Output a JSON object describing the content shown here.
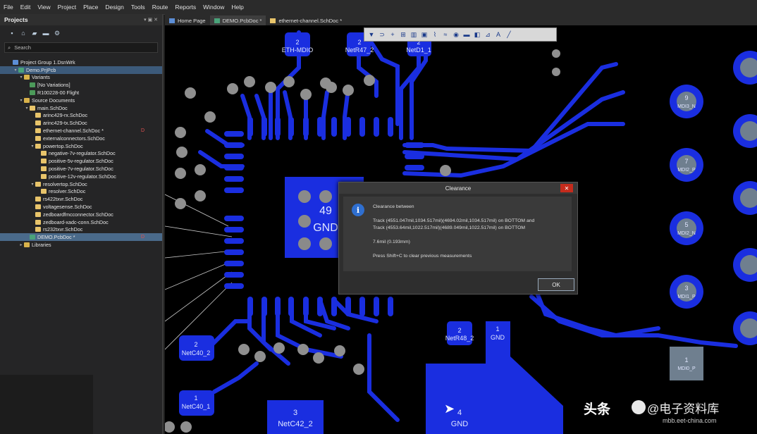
{
  "menu": [
    "File",
    "Edit",
    "View",
    "Project",
    "Place",
    "Design",
    "Tools",
    "Route",
    "Reports",
    "Window",
    "Help"
  ],
  "projects_panel": {
    "title": "Projects",
    "pin": "▾ ▣ ✕",
    "search_placeholder": "Search",
    "tree": [
      {
        "label": "Project Group 1.DsnWrk",
        "indent": 0,
        "icon": "prj",
        "arrow": ""
      },
      {
        "label": "Demo.PrjPcb",
        "indent": 1,
        "icon": "pcb",
        "arrow": "▾",
        "selected": true
      },
      {
        "label": "Variants",
        "indent": 2,
        "icon": "folder",
        "arrow": "▾"
      },
      {
        "label": "[No Variations]",
        "indent": 3,
        "icon": "var",
        "arrow": ""
      },
      {
        "label": "R100228-00 Flight",
        "indent": 3,
        "icon": "var",
        "arrow": ""
      },
      {
        "label": "Source Documents",
        "indent": 2,
        "icon": "folder",
        "arrow": "▾"
      },
      {
        "label": "main.SchDoc",
        "indent": 3,
        "icon": "sch",
        "arrow": "▾"
      },
      {
        "label": "arinc429-rx.SchDoc",
        "indent": 4,
        "icon": "sch",
        "arrow": ""
      },
      {
        "label": "arinc429-tx.SchDoc",
        "indent": 4,
        "icon": "sch",
        "arrow": ""
      },
      {
        "label": "ethernet-channel.SchDoc *",
        "indent": 4,
        "icon": "sch",
        "arrow": "",
        "mark": "D"
      },
      {
        "label": "externalconnectors.SchDoc",
        "indent": 4,
        "icon": "sch",
        "arrow": ""
      },
      {
        "label": "powertop.SchDoc",
        "indent": 4,
        "icon": "sch",
        "arrow": "▾"
      },
      {
        "label": "negative-7v-regulator.SchDoc",
        "indent": 5,
        "icon": "sch",
        "arrow": ""
      },
      {
        "label": "positive-5v-regulator.SchDoc",
        "indent": 5,
        "icon": "sch",
        "arrow": ""
      },
      {
        "label": "positive-7v-regulator.SchDoc",
        "indent": 5,
        "icon": "sch",
        "arrow": ""
      },
      {
        "label": "positive-12v-regulator.SchDoc",
        "indent": 5,
        "icon": "sch",
        "arrow": ""
      },
      {
        "label": "resolvertop.SchDoc",
        "indent": 4,
        "icon": "sch",
        "arrow": "▾"
      },
      {
        "label": "resolver.SchDoc",
        "indent": 5,
        "icon": "sch",
        "arrow": ""
      },
      {
        "label": "rs422txvr.SchDoc",
        "indent": 4,
        "icon": "sch",
        "arrow": ""
      },
      {
        "label": "voltagesense.SchDoc",
        "indent": 4,
        "icon": "sch",
        "arrow": ""
      },
      {
        "label": "zedboardfmcconnector.SchDoc",
        "indent": 4,
        "icon": "sch",
        "arrow": ""
      },
      {
        "label": "zedboard-xadc-conn.SchDoc",
        "indent": 4,
        "icon": "sch",
        "arrow": ""
      },
      {
        "label": "rs232txvr.SchDoc",
        "indent": 4,
        "icon": "sch",
        "arrow": ""
      },
      {
        "label": "DEMO.PcbDoc *",
        "indent": 3,
        "icon": "pcb",
        "arrow": "",
        "mark": "D",
        "highlight": true
      },
      {
        "label": "Libraries",
        "indent": 2,
        "icon": "folder",
        "arrow": "▸"
      }
    ]
  },
  "tabs": [
    {
      "label": "Home Page",
      "active": false
    },
    {
      "label": "DEMO.PcbDoc *",
      "active": true
    },
    {
      "label": "ethernet-channel.SchDoc *",
      "active": false
    }
  ],
  "pcb_labels": {
    "eth_mdio_num": "2",
    "eth_mdio": "ETH-MDIO",
    "netr47_num": "2",
    "netr47": "NetR47_2",
    "netd1_num": "2",
    "netd1": "NetD1_1",
    "gnd49_num": "49",
    "gnd49": "GND",
    "netr48_num": "2",
    "netr48": "NetR48_2",
    "gnd1_num": "1",
    "gnd1": "GND",
    "netc40_2_num": "2",
    "netc40_2": "NetC40_2",
    "netc40_1_num": "1",
    "netc40_1": "NetC40_1",
    "netc42_num": "3",
    "netc42": "NetC42_2",
    "gnd4_num": "4",
    "gnd4": "GND",
    "right_pads": [
      {
        "num": "9",
        "net": "MDI3_N"
      },
      {
        "num": "7",
        "net": "MDI2_P"
      },
      {
        "num": "5",
        "net": "MDI2_N"
      },
      {
        "num": "3",
        "net": "MDI1_P"
      },
      {
        "num": "1",
        "net": "MDI0_P"
      }
    ]
  },
  "dialog": {
    "title": "Clearance",
    "close": "✕",
    "line1": "Clearance between",
    "line2": "Track (4551.047mil,1034.517mil)(4694.02mil,1034.517mil) on BOTTOM and",
    "line3": "Track (4553.64mil,1022.517mil)(4689.049mil,1022.517mil) on BOTTOM",
    "line4": "7.6mil (0.193mm)",
    "line5": "Press Shift+C to clear previous measurements",
    "ok": "OK"
  },
  "watermark": {
    "a": "头条",
    "b": "@电子资料库",
    "url": "mbb.eet-china.com"
  }
}
